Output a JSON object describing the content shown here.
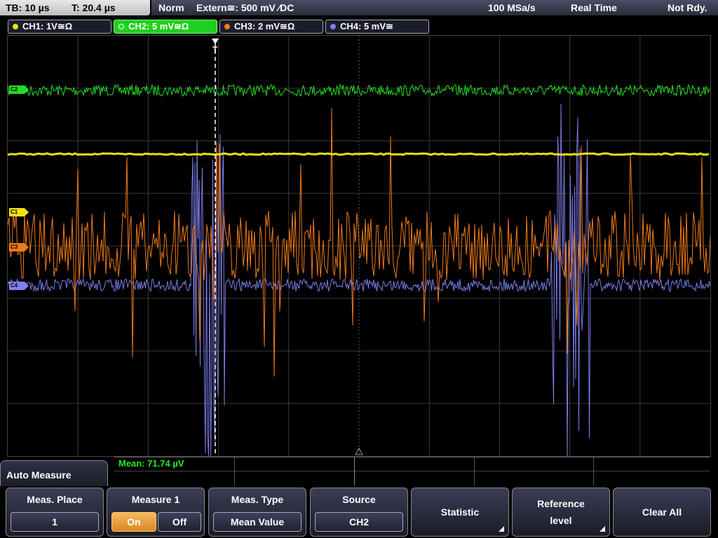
{
  "topbar": {
    "tb": "TB: 10 µs",
    "trigger_time": "T: 20.4 µs",
    "mode": "Norm",
    "trigger": "Extern≅: 500 mV ⁄DC",
    "sample_rate": "100 MSa/s",
    "acq_mode": "Real Time",
    "state": "Not Rdy."
  },
  "channels": [
    {
      "label": "CH1: 1V≅Ω",
      "color": "#f0e010"
    },
    {
      "label": "CH2: 5 mV≅Ω",
      "color": "#22dd22"
    },
    {
      "label": "CH3: 2 mV≅Ω",
      "color": "#f07a18"
    },
    {
      "label": "CH4: 5 mV≅",
      "color": "#8080f0"
    }
  ],
  "markers": {
    "ch2": "C2",
    "c1": "C1",
    "c3": "C3",
    "c4": "C4",
    "trigger": "T"
  },
  "measurement": {
    "mean": "Mean: 71.74 µV"
  },
  "menu": {
    "title": "Auto Measure",
    "meas_place": {
      "title": "Meas. Place",
      "value": "1"
    },
    "measure1": {
      "title": "Measure 1",
      "on": "On",
      "off": "Off"
    },
    "meas_type": {
      "title": "Meas. Type",
      "value": "Mean Value"
    },
    "source": {
      "title": "Source",
      "value": "CH2"
    },
    "statistic": "Statistic",
    "reference_level": "Reference level",
    "clear_all": "Clear All"
  }
}
